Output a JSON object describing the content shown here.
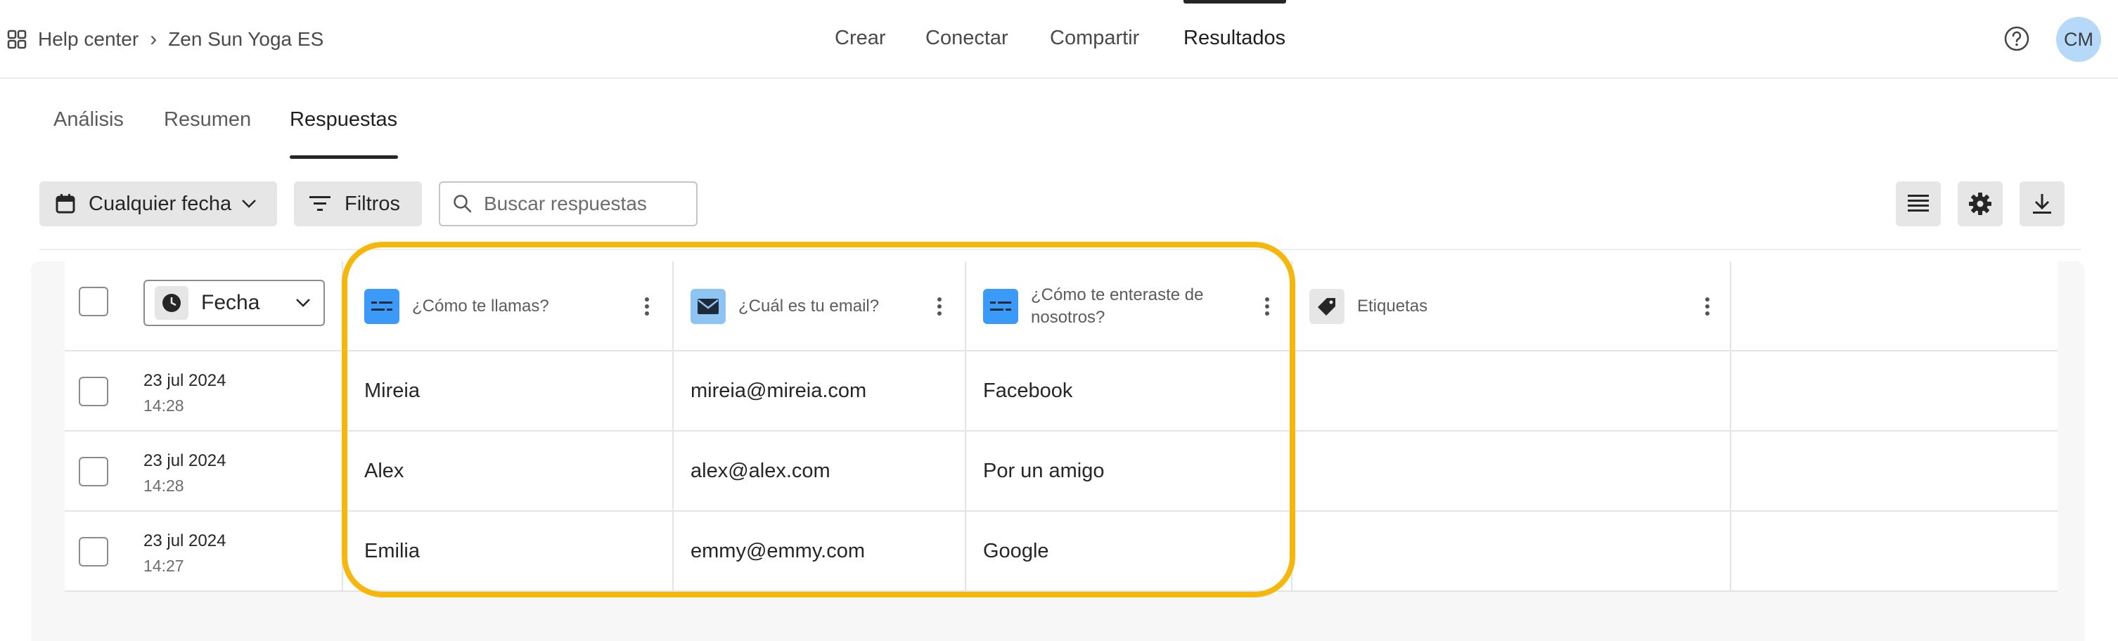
{
  "breadcrumb": {
    "root": "Help center",
    "separator": "›",
    "current": "Zen Sun Yoga ES"
  },
  "nav": {
    "items": [
      "Crear",
      "Conectar",
      "Compartir",
      "Resultados"
    ],
    "active": "Resultados"
  },
  "user": {
    "initials": "CM"
  },
  "subtabs": {
    "items": [
      "Análisis",
      "Resumen",
      "Respuestas"
    ],
    "active": "Respuestas"
  },
  "toolbar": {
    "date_filter": "Cualquier fecha",
    "filters": "Filtros",
    "search_placeholder": "Buscar respuestas"
  },
  "table": {
    "date_column": "Fecha",
    "columns": [
      {
        "label": "¿Cómo te llamas?",
        "icon": "short-text-icon",
        "color": "#3b9af8"
      },
      {
        "label": "¿Cuál es tu email?",
        "icon": "email-icon",
        "color": "#8ec4f3"
      },
      {
        "label": "¿Cómo te enteraste de nosotros?",
        "icon": "short-text-icon",
        "color": "#3b9af8"
      },
      {
        "label": "Etiquetas",
        "icon": "tag-icon",
        "color": "#e6e6e6"
      }
    ],
    "rows": [
      {
        "date": "23 jul 2024",
        "time": "14:28",
        "name": "Mireia",
        "email": "mireia@mireia.com",
        "source": "Facebook",
        "tags": ""
      },
      {
        "date": "23 jul 2024",
        "time": "14:28",
        "name": "Alex",
        "email": "alex@alex.com",
        "source": "Por un amigo",
        "tags": ""
      },
      {
        "date": "23 jul 2024",
        "time": "14:27",
        "name": "Emilia",
        "email": "emmy@emmy.com",
        "source": "Google",
        "tags": ""
      }
    ]
  },
  "colors": {
    "accent": "#3b9af8",
    "highlight": "#f6b70d",
    "avatar": "#b6d9f9"
  }
}
